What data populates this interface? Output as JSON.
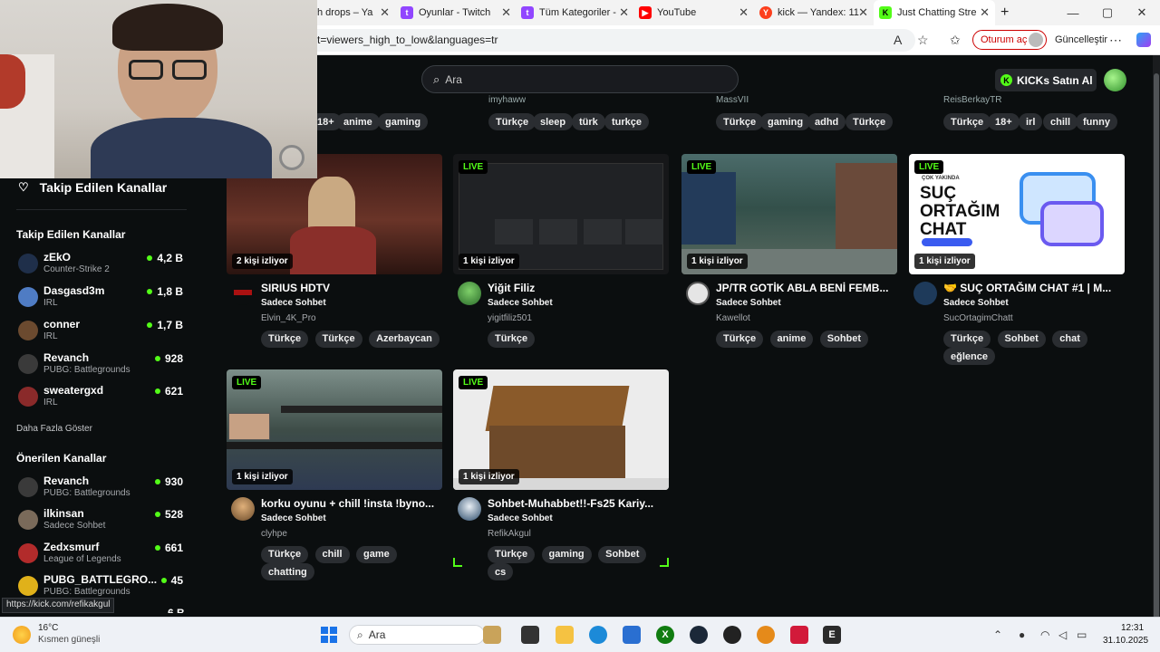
{
  "browser": {
    "tabs": [
      {
        "title": "h drops – Ya",
        "icon": "kick-icon",
        "active": false
      },
      {
        "title": "Oyunlar - Twitch",
        "icon": "twitch-icon",
        "active": false
      },
      {
        "title": "Tüm Kategoriler -",
        "icon": "twitch-icon",
        "active": false
      },
      {
        "title": "YouTube",
        "icon": "youtube-icon",
        "active": false
      },
      {
        "title": "kick — Yandex: 11",
        "icon": "yandex-icon",
        "active": false
      },
      {
        "title": "Just Chatting Stre",
        "icon": "kick-icon",
        "active": true
      }
    ],
    "new_tab": "+",
    "url": "t=viewers_high_to_low&languages=tr",
    "signin_label": "Oturum aç",
    "update_label": "Güncelleştir",
    "status_url": "https://kick.com/refikakgul"
  },
  "header": {
    "search_placeholder": "Ara",
    "kicks_label": "KICKs Satın Al"
  },
  "top_row": {
    "users": [
      "imyhaww",
      "MassVII",
      "ReisBerkayTR"
    ],
    "tags_col1": [
      "18+",
      "anime",
      "gaming"
    ],
    "tags_col2": [
      "Türkçe",
      "sleep",
      "türk",
      "turkçe"
    ],
    "tags_col3": [
      "Türkçe",
      "gaming",
      "adhd",
      "Türkçe"
    ],
    "tags_col4": [
      "Türkçe",
      "18+",
      "irl",
      "chill",
      "funny"
    ]
  },
  "sidebar": {
    "follow_link": "Takip Edilen Kanallar",
    "followed_heading": "Takip Edilen Kanallar",
    "followed": [
      {
        "name": "zEkO",
        "category": "Counter-Strike 2",
        "viewers": "4,2 B",
        "color": "#2b4a7a"
      },
      {
        "name": "Dasgasd3m",
        "category": "IRL",
        "viewers": "1,8 B",
        "color": "#4f7cc4"
      },
      {
        "name": "conner",
        "category": "IRL",
        "viewers": "1,7 B",
        "color": "#6b4a2f"
      },
      {
        "name": "Revanch",
        "category": "PUBG: Battlegrounds",
        "viewers": "928",
        "color": "#3a3a3a"
      },
      {
        "name": "sweatergxd",
        "category": "IRL",
        "viewers": "621",
        "color": "#8a2a2a"
      }
    ],
    "show_more": "Daha Fazla Göster",
    "recommended_heading": "Önerilen Kanallar",
    "recommended": [
      {
        "name": "Revanch",
        "category": "PUBG: Battlegrounds",
        "viewers": "930",
        "color": "#3a3a3a"
      },
      {
        "name": "ilkinsan",
        "category": "Sadece Sohbet",
        "viewers": "528",
        "color": "#7a6a5a"
      },
      {
        "name": "Zedxsmurf",
        "category": "League of Legends",
        "viewers": "661",
        "color": "#b22b2b"
      },
      {
        "name": "PUBG_BATTLEGRO...",
        "category": "PUBG: Battlegrounds",
        "viewers": "45",
        "color": "#e0b11a"
      }
    ],
    "cut_viewers": "6 B"
  },
  "cards": [
    {
      "title": "SIRIUS HDTV",
      "category": "Sadece Sohbet",
      "user": "Elvin_4K_Pro",
      "viewers": "2 kişi izliyor",
      "live": "",
      "tags": [
        "Türkçe",
        "Türkçe",
        "Azerbaycan"
      ],
      "thumb": "#5a2a22",
      "avatar": "#5a1111"
    },
    {
      "title": "Yiğit Filiz",
      "category": "Sadece Sohbet",
      "user": "yigitfiliz501",
      "viewers": "1 kişi izliyor",
      "live": "LIVE",
      "tags": [
        "Türkçe"
      ],
      "thumb": "#1d1f22",
      "avatar": "#3c7a3a"
    },
    {
      "title": "JP/TR GOTİK ABLA BENİ FEMB...",
      "category": "Sadece Sohbet",
      "user": "Kawellot",
      "viewers": "1 kişi izliyor",
      "live": "LIVE",
      "tags": [
        "Türkçe",
        "anime",
        "Sohbet"
      ],
      "thumb": "#3b5a4a",
      "avatar": "#d9d9d9"
    },
    {
      "title": "🤝 SUÇ ORTAĞIM CHAT #1 | M...",
      "category": "Sadece Sohbet",
      "user": "SucOrtagimChatt",
      "viewers": "1 kişi izliyor",
      "live": "LIVE",
      "tags": [
        "Türkçe",
        "Sohbet",
        "chat",
        "eğlence"
      ],
      "thumb": "#ffffff",
      "avatar": "#1e3a5a",
      "thumb_text": "SUÇ ORTAĞIM CHAT",
      "thumb_small": "ÇOK YAKINDA"
    },
    {
      "title": "korku oyunu + chill !insta !byno...",
      "category": "Sadece Sohbet",
      "user": "clyhpe",
      "viewers": "1 kişi izliyor",
      "live": "LIVE",
      "tags": [
        "Türkçe",
        "chill",
        "game",
        "chatting"
      ],
      "thumb": "#4a5a4a",
      "avatar": "#b58a4a"
    },
    {
      "title": "Sohbet-Muhabbet!!-Fs25 Kariy...",
      "category": "Sadece Sohbet",
      "user": "RefikAkgul",
      "viewers": "1 kişi izliyor",
      "live": "LIVE",
      "tags": [
        "Türkçe",
        "gaming",
        "Sohbet",
        "cs"
      ],
      "thumb": "#e8e8e8",
      "avatar": "#2a4a6a"
    }
  ],
  "taskbar": {
    "temp": "16°C",
    "weather": "Kısmen güneşli",
    "search": "Ara",
    "time": "12:31",
    "date": "31.10.2025"
  },
  "colors": {
    "accent": "#53fc18",
    "bg": "#0b0e0f",
    "tag_bg": "#2a2d31"
  }
}
